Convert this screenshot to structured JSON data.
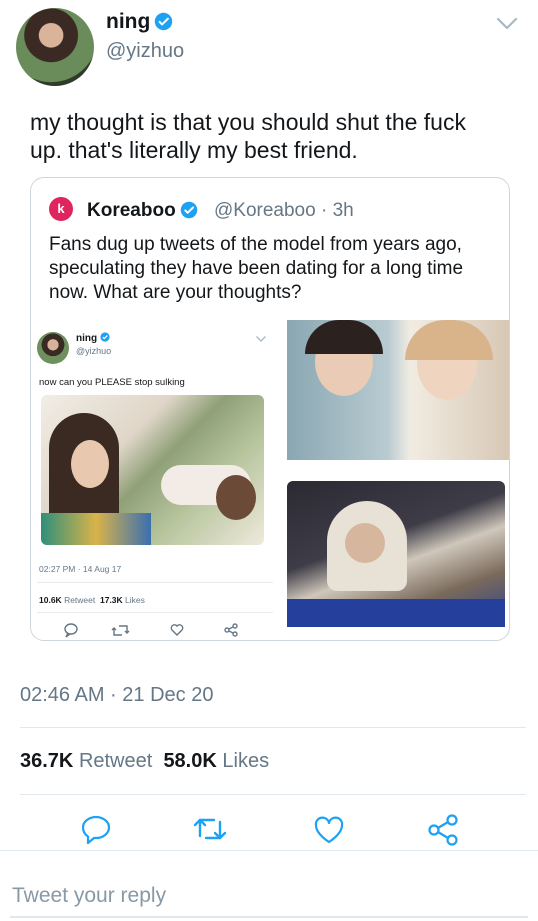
{
  "author": {
    "name": "ning",
    "handle": "@yizhuo",
    "verified": true
  },
  "tweet": {
    "text": "my thought is that you should shut the fuck up. that's literally my best friend."
  },
  "quote": {
    "logo_letter": "k",
    "name": "Koreaboo",
    "handle": "@Koreaboo",
    "time": "· 3h",
    "text": "Fans dug up tweets of the model from years ago, speculating they have been dating for a long time now. What are your thoughts?",
    "embedded": {
      "name": "ning",
      "handle": "@yizhuo",
      "text": "now can you PLEASE stop sulking",
      "timestamp": "02:27 PM · 14 Aug 17",
      "retweets": "10.6K",
      "retweet_label": "Retweet",
      "likes": "17.3K",
      "likes_label": "Likes"
    }
  },
  "meta": {
    "timestamp": "02:46 AM · 21 Dec 20",
    "retweets": "36.7K",
    "retweet_label": "Retweet",
    "likes": "58.0K",
    "likes_label": "Likes"
  },
  "actions": [
    "reply-icon",
    "retweet-icon",
    "like-icon",
    "share-icon"
  ],
  "reply_box": {
    "placeholder": "Tweet your reply"
  },
  "colors": {
    "verified": "#1da1f2",
    "koreaboo": "#e0245e",
    "secondary": "#657786"
  }
}
